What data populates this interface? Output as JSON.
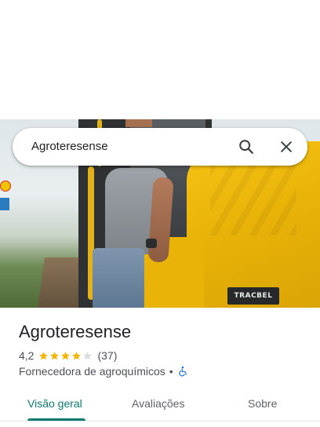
{
  "colors": {
    "accent": "#0b7a6f",
    "star": "#f4b400",
    "star_empty": "#dadce0",
    "text_primary": "#202124",
    "text_secondary": "#4d5156"
  },
  "search": {
    "query": "Agroteresense",
    "search_icon": "search-icon",
    "close_icon": "close-icon"
  },
  "hero_image": {
    "plate_text": "TRACBEL"
  },
  "place": {
    "name": "Agroteresense",
    "rating": "4,2",
    "rating_value": 4.2,
    "stars_filled": 4,
    "stars_total": 5,
    "review_count": "(37)",
    "category": "Fornecedora de agroquímicos",
    "separator": "•",
    "accessibility_icon": "wheelchair-icon"
  },
  "tabs": [
    {
      "label": "Visão geral",
      "active": true
    },
    {
      "label": "Avaliações",
      "active": false
    },
    {
      "label": "Sobre",
      "active": false
    }
  ]
}
